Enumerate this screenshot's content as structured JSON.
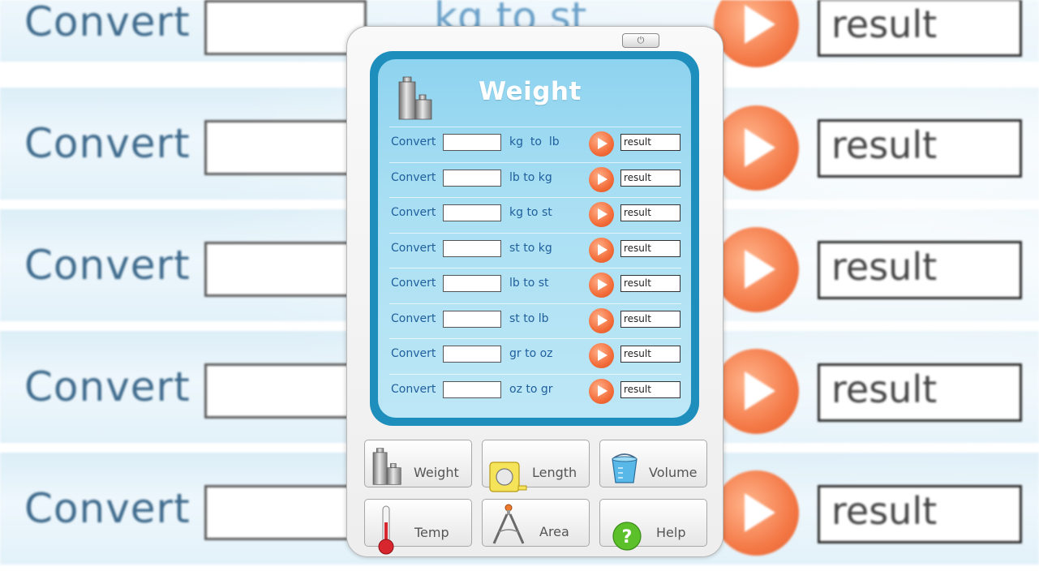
{
  "background": {
    "convert_label": "Convert",
    "unit_label": "kg to st",
    "result_label": "result"
  },
  "gadget": {
    "power_glyph": "⏻",
    "title": "Weight",
    "title_icon": "weights-icon",
    "accent_color": "#1e8fbd",
    "go_button_color": "#f36d3a",
    "rows": [
      {
        "label": "Convert",
        "unit": "kg  to  lb",
        "result": "result"
      },
      {
        "label": "Convert",
        "unit": "lb to kg",
        "result": "result"
      },
      {
        "label": "Convert",
        "unit": "kg to st",
        "result": "result"
      },
      {
        "label": "Convert",
        "unit": "st to kg",
        "result": "result"
      },
      {
        "label": "Convert",
        "unit": "lb to st",
        "result": "result"
      },
      {
        "label": "Convert",
        "unit": "st to lb",
        "result": "result"
      },
      {
        "label": "Convert",
        "unit": "gr to oz",
        "result": "result"
      },
      {
        "label": "Convert",
        "unit": "oz to gr",
        "result": "result"
      }
    ],
    "nav": [
      {
        "label": "Weight",
        "icon": "weights-icon"
      },
      {
        "label": "Length",
        "icon": "tape-measure-icon"
      },
      {
        "label": "Volume",
        "icon": "bucket-icon"
      },
      {
        "label": "Temp",
        "icon": "thermometer-icon"
      },
      {
        "label": "Area",
        "icon": "compass-icon"
      },
      {
        "label": "Help",
        "icon": "help-icon"
      }
    ]
  }
}
